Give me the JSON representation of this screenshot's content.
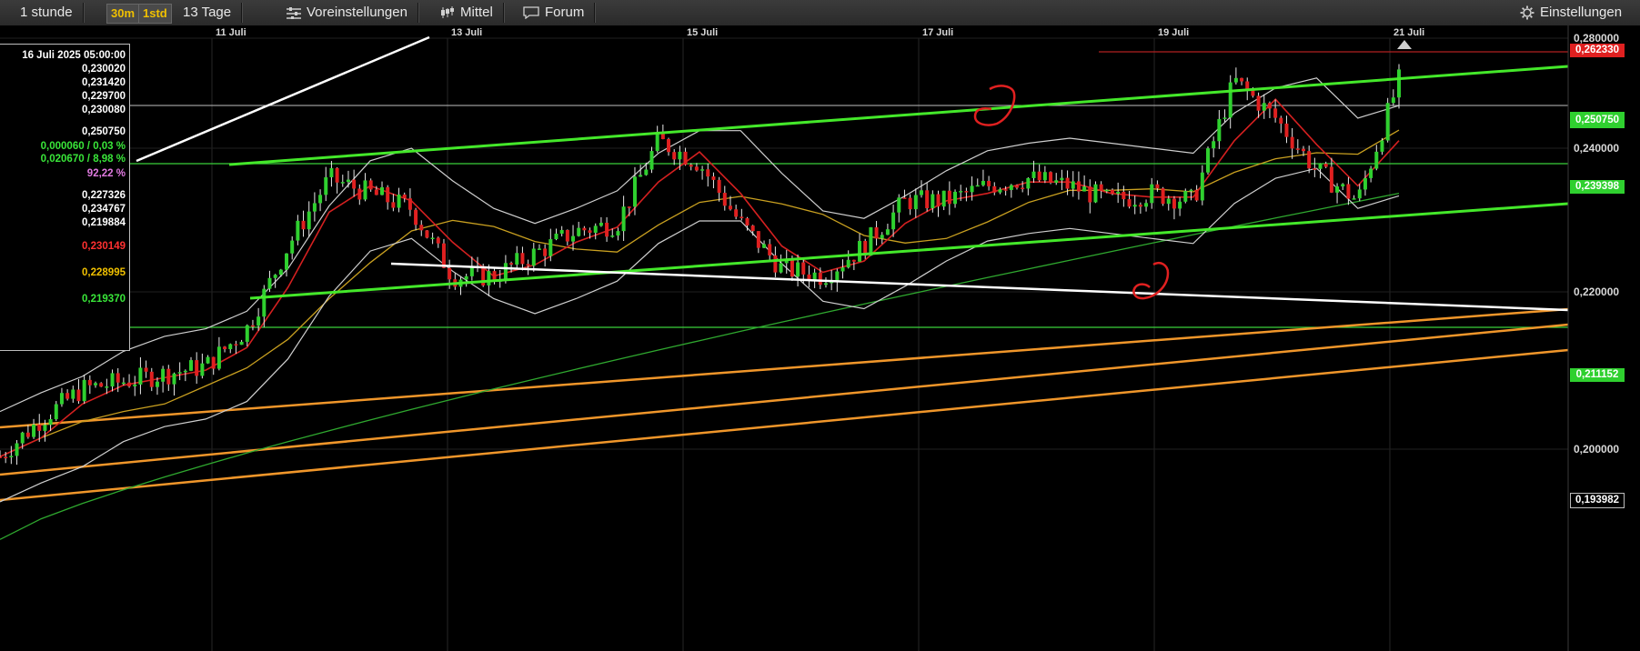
{
  "toolbar": {
    "interval": "1 stunde",
    "res_30m": "30m",
    "res_1std": "1std",
    "range": "13 Tage",
    "presets": "Voreinstellungen",
    "indicator": "Mittel",
    "forum": "Forum",
    "settings": "Einstellungen"
  },
  "colors": {
    "background": "#000000",
    "candle_up": "#2fd02f",
    "candle_down": "#e02020",
    "ma_fast": "#d42020",
    "ma_mid": "#c9a020",
    "ma_slow": "#2fa82f",
    "bollinger": "#cfcfcf",
    "trend_channel": "#44e82a",
    "support_lines": "#f0962a",
    "accent_yellow": "#f0c000"
  },
  "infobox": {
    "date": "16 Juli 2025 05:00:00",
    "rows": [
      {
        "text": "0,230020",
        "color": "#ffffff"
      },
      {
        "text": "0,231420",
        "color": "#ffffff"
      },
      {
        "text": "0,229700",
        "color": "#ffffff"
      },
      {
        "text": "0,230080",
        "color": "#ffffff"
      },
      {
        "text": "0,250750",
        "color": "#ffffff"
      },
      {
        "text": "0,000060 / 0,03 %",
        "color": "#39e639"
      },
      {
        "text": "0,020670 / 8,98 %",
        "color": "#39e639"
      },
      {
        "text": "92,22 %",
        "color": "#e07ae0"
      },
      {
        "text": "0,227326",
        "color": "#ffffff"
      },
      {
        "text": "0,234767",
        "color": "#ffffff"
      },
      {
        "text": "0,219884",
        "color": "#ffffff"
      },
      {
        "text": "0,230149",
        "color": "#ff3030"
      },
      {
        "text": "0,228995",
        "color": "#f0c000"
      },
      {
        "text": "0,219370",
        "color": "#39e639"
      }
    ]
  },
  "price_labels": {
    "top_red": "0,262330",
    "last": "0,250750",
    "green_upper": "0,239398",
    "green_lower": "0,211152",
    "bottom": "0,193982"
  },
  "chart_data": {
    "type": "line",
    "title": "",
    "xlabel": "",
    "ylabel": "",
    "x_ticks": [
      "11 Juli",
      "13 Juli",
      "15 Juli",
      "17 Juli",
      "19 Juli",
      "21 Juli"
    ],
    "y_ticks": [
      "0,280000",
      "0,240000",
      "0,220000",
      "0,200000"
    ],
    "ylim": [
      0.186,
      0.266
    ],
    "x": [
      "09.07. 20:00",
      "10.07. 04:00",
      "10.07. 12:00",
      "10.07. 20:00",
      "11.07. 04:00",
      "11.07. 12:00",
      "11.07. 20:00",
      "12.07. 04:00",
      "12.07. 12:00",
      "12.07. 20:00",
      "13.07. 04:00",
      "13.07. 12:00",
      "13.07. 20:00",
      "14.07. 04:00",
      "14.07. 12:00",
      "14.07. 20:00",
      "15.07. 04:00",
      "15.07. 12:00",
      "15.07. 20:00",
      "16.07. 04:00",
      "16.07. 12:00",
      "16.07. 20:00",
      "17.07. 04:00",
      "17.07. 12:00",
      "17.07. 20:00",
      "18.07. 04:00",
      "18.07. 12:00",
      "18.07. 20:00",
      "19.07. 04:00",
      "19.07. 12:00",
      "19.07. 20:00",
      "20.07. 04:00",
      "20.07. 12:00",
      "20.07. 20:00",
      "21.07. 04:00"
    ],
    "series": [
      {
        "name": "",
        "values": [
          0.199,
          0.204,
          0.208,
          0.209,
          0.21,
          0.211,
          0.216,
          0.227,
          0.236,
          0.234,
          0.232,
          0.223,
          0.223,
          0.226,
          0.229,
          0.23,
          0.241,
          0.238,
          0.23,
          0.224,
          0.223,
          0.227,
          0.233,
          0.233,
          0.235,
          0.236,
          0.235,
          0.233,
          0.234,
          0.233,
          0.249,
          0.244,
          0.237,
          0.233,
          0.249
        ]
      }
    ],
    "horizontal_lines": [
      0.26233,
      0.25075,
      0.239398,
      0.211152
    ],
    "grid": true
  }
}
